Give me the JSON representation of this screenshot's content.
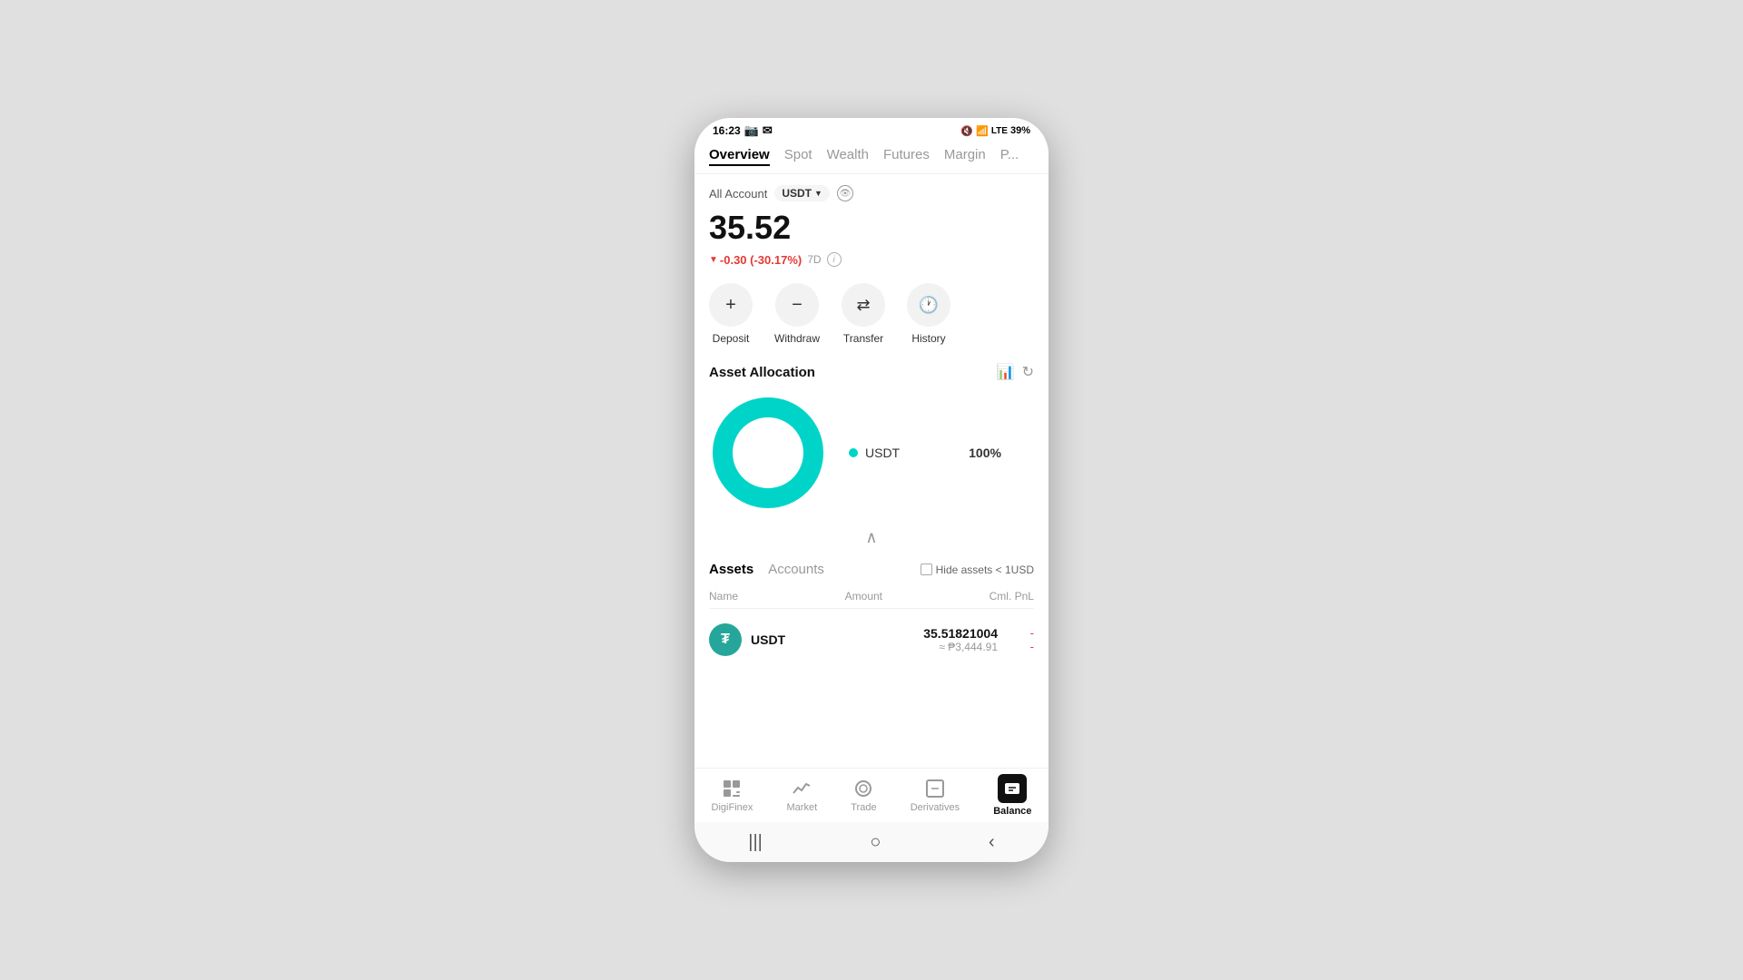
{
  "statusBar": {
    "time": "16:23",
    "battery": "39%",
    "batteryIcon": "🔋"
  },
  "navTabs": [
    {
      "label": "Overview",
      "active": true
    },
    {
      "label": "Spot",
      "active": false
    },
    {
      "label": "Wealth",
      "active": false
    },
    {
      "label": "Futures",
      "active": false
    },
    {
      "label": "Margin",
      "active": false
    },
    {
      "label": "P...",
      "active": false
    }
  ],
  "account": {
    "label": "All Account",
    "currency": "USDT"
  },
  "balance": {
    "amount": "35.52",
    "change": "-0.30 (-30.17%)",
    "period": "7D"
  },
  "actions": [
    {
      "label": "Deposit",
      "icon": "+"
    },
    {
      "label": "Withdraw",
      "icon": "−"
    },
    {
      "label": "Transfer",
      "icon": "⇄"
    },
    {
      "label": "History",
      "icon": "🕐"
    }
  ],
  "assetAllocation": {
    "title": "Asset Allocation",
    "chartData": [
      {
        "label": "USDT",
        "pct": 100,
        "color": "#00d4c8"
      }
    ]
  },
  "assetsTabs": [
    {
      "label": "Assets",
      "active": true
    },
    {
      "label": "Accounts",
      "active": false
    }
  ],
  "hideAssetsLabel": "Hide assets < 1USD",
  "tableHeaders": {
    "name": "Name",
    "amount": "Amount",
    "cmlPnl": "Cml. PnL"
  },
  "assets": [
    {
      "symbol": "USDT",
      "iconText": "₮",
      "amount": "35.51821004",
      "subAmount": "≈ ₱3,444.91",
      "pnl": "-",
      "pnlSub": "-"
    }
  ],
  "bottomNav": [
    {
      "label": "DigiFinex",
      "icon": "⟳",
      "active": false
    },
    {
      "label": "Market",
      "icon": "📈",
      "active": false
    },
    {
      "label": "Trade",
      "icon": "◎",
      "active": false
    },
    {
      "label": "Derivatives",
      "icon": "▣",
      "active": false
    },
    {
      "label": "Balance",
      "icon": "₩",
      "active": true
    }
  ],
  "systemNav": {
    "menu": "|||",
    "home": "○",
    "back": "‹"
  }
}
